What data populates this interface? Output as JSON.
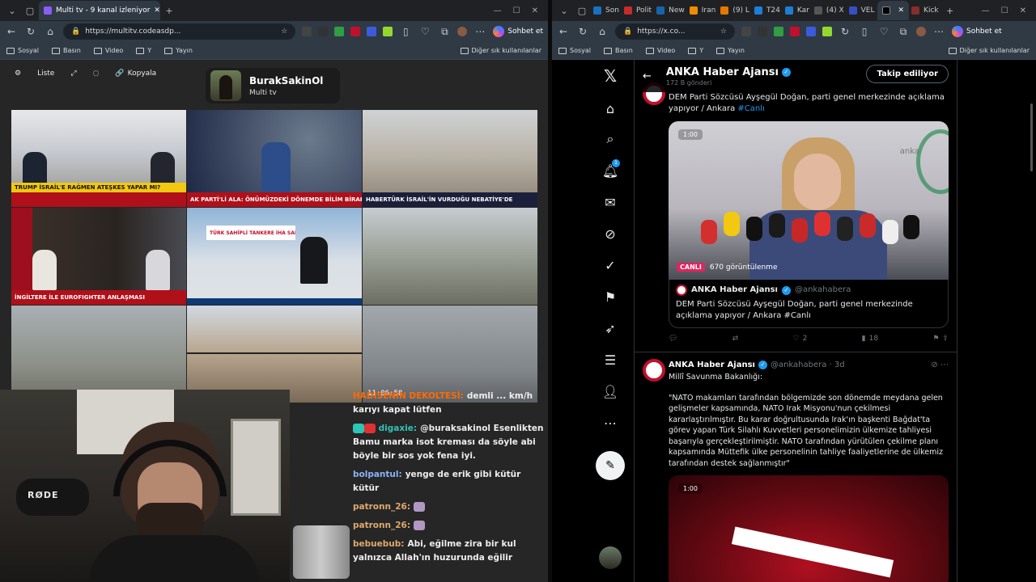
{
  "left": {
    "tabs": [
      {
        "label": "Multi tv - 9 kanal izleniyor",
        "active": true
      }
    ],
    "url": "https://multitv.codeasdp...",
    "copilot": "Sohbet et",
    "bookmarks": [
      "Sosyal",
      "Basın",
      "Video",
      "Y",
      "Yayın"
    ],
    "bookmarks_other": "Diğer sık kullanılanlar",
    "toolbar": {
      "list": "Liste",
      "copy": "Kopyala"
    },
    "channel": {
      "name": "BurakSakinOl",
      "sub": "Multi tv"
    },
    "tiles": [
      {
        "lower": "TRUMP İSRAİL'E RAĞMEN ATEŞKES YAPAR MI?",
        "style": "yellow"
      },
      {
        "lower": "AK PARTİ'Lİ ALA: ÖNÜMÜZDEKİ DÖNEMDE BİLİM BİRAKMAYIZ",
        "style": "red"
      },
      {
        "lower": "HABERTÜRK İSRAİL'İN VURDUĞU NEBATİYE'DE",
        "style": "red"
      },
      {
        "lower": "İNGİLTERE İLE EUROFIGHTER ANLAŞMASI",
        "style": "red"
      },
      {
        "lower": "TÜRK SAHİPLİ TANKERE İHA SALDIRISI",
        "style": "blue"
      },
      {
        "lower": "",
        "style": "none"
      },
      {
        "lower": "",
        "style": "none"
      },
      {
        "lower": "",
        "style": "none"
      },
      {
        "lower": "",
        "style": "none",
        "clock": "11:06:58"
      }
    ],
    "chat": [
      {
        "user": "HADİSENİN DEKOLTESİ:",
        "color": "#ff6a00",
        "text": "demli ... km/h karıyı kapat lütfen"
      },
      {
        "user": "digaxie:",
        "color": "#2ec4b6",
        "text": "@buraksakinol Esenlikten Bamu marka isot kreması da söyle abi böyle bir sos yok fena iyi."
      },
      {
        "user": "bolpantul:",
        "color": "#8ab4f8",
        "text": "yenge de erik gibi kütür kütür"
      },
      {
        "user": "patronn_26:",
        "color": "#e0a96d",
        "text": ""
      },
      {
        "user": "patronn_26:",
        "color": "#e0a96d",
        "text": ""
      },
      {
        "user": "bebuebub:",
        "color": "#e0a96d",
        "text": "Abi, eğilme zira bir kul yalnızca Allah'ın huzurunda eğilir"
      }
    ],
    "mic_brand": "RØDE"
  },
  "right": {
    "tabs": [
      {
        "label": "Son"
      },
      {
        "label": "Polit"
      },
      {
        "label": "New"
      },
      {
        "label": "Iran"
      },
      {
        "label": "(9) L"
      },
      {
        "label": "T24"
      },
      {
        "label": "Kar"
      },
      {
        "label": "(4) X"
      },
      {
        "label": "VEL"
      },
      {
        "label": "",
        "active": true
      },
      {
        "label": "Kick"
      }
    ],
    "url": "https://x.co...",
    "copilot": "Sohbet et",
    "bookmarks": [
      "Sosyal",
      "Basın",
      "Video",
      "Y",
      "Yayın"
    ],
    "bookmarks_other": "Diğer sık kullanılanlar",
    "header": {
      "name": "ANKA Haber Ajansı",
      "count": "172 B gönderi",
      "follow": "Takip ediliyor"
    },
    "notif_count": "1",
    "tweet1": {
      "text": "DEM Parti Sözcüsü Ayşegül Doğan, parti genel merkezinde açıklama yapıyor / Ankara",
      "hashtag": "#Canlı",
      "video_badge": "1:00",
      "live": "CANLI",
      "views": "670 görüntülenme",
      "video_logo": "anka",
      "quote_name": "ANKA Haber Ajansı",
      "quote_handle": "@ankahabera",
      "quote_text": "DEM Parti Sözcüsü Ayşegül Doğan, parti genel merkezinde açıklama yapıyor / Ankara #Canlı",
      "likes": "2",
      "views_count": "18"
    },
    "tweet2": {
      "name": "ANKA Haber Ajansı",
      "handle": "@ankahabera · 3d",
      "intro": "Millî Savunma Bakanlığı:",
      "text": "\"NATO makamları tarafından bölgemizde son dönemde meydana gelen gelişmeler kapsamında, NATO Irak Misyonu'nun çekilmesi kararlaştırılmıştır. Bu karar doğrultusunda Irak'ın başkenti Bağdat'ta görev yapan Türk Silahlı Kuvvetleri personelimizin ülkemize tahliyesi başarıyla gerçekleştirilmiştir. NATO tarafından yürütülen çekilme planı kapsamında Müttefik ülke personelinin tahliye faaliyetlerine de ülkemiz tarafından destek sağlanmıştır\"",
      "video_badge": "1:00"
    }
  }
}
